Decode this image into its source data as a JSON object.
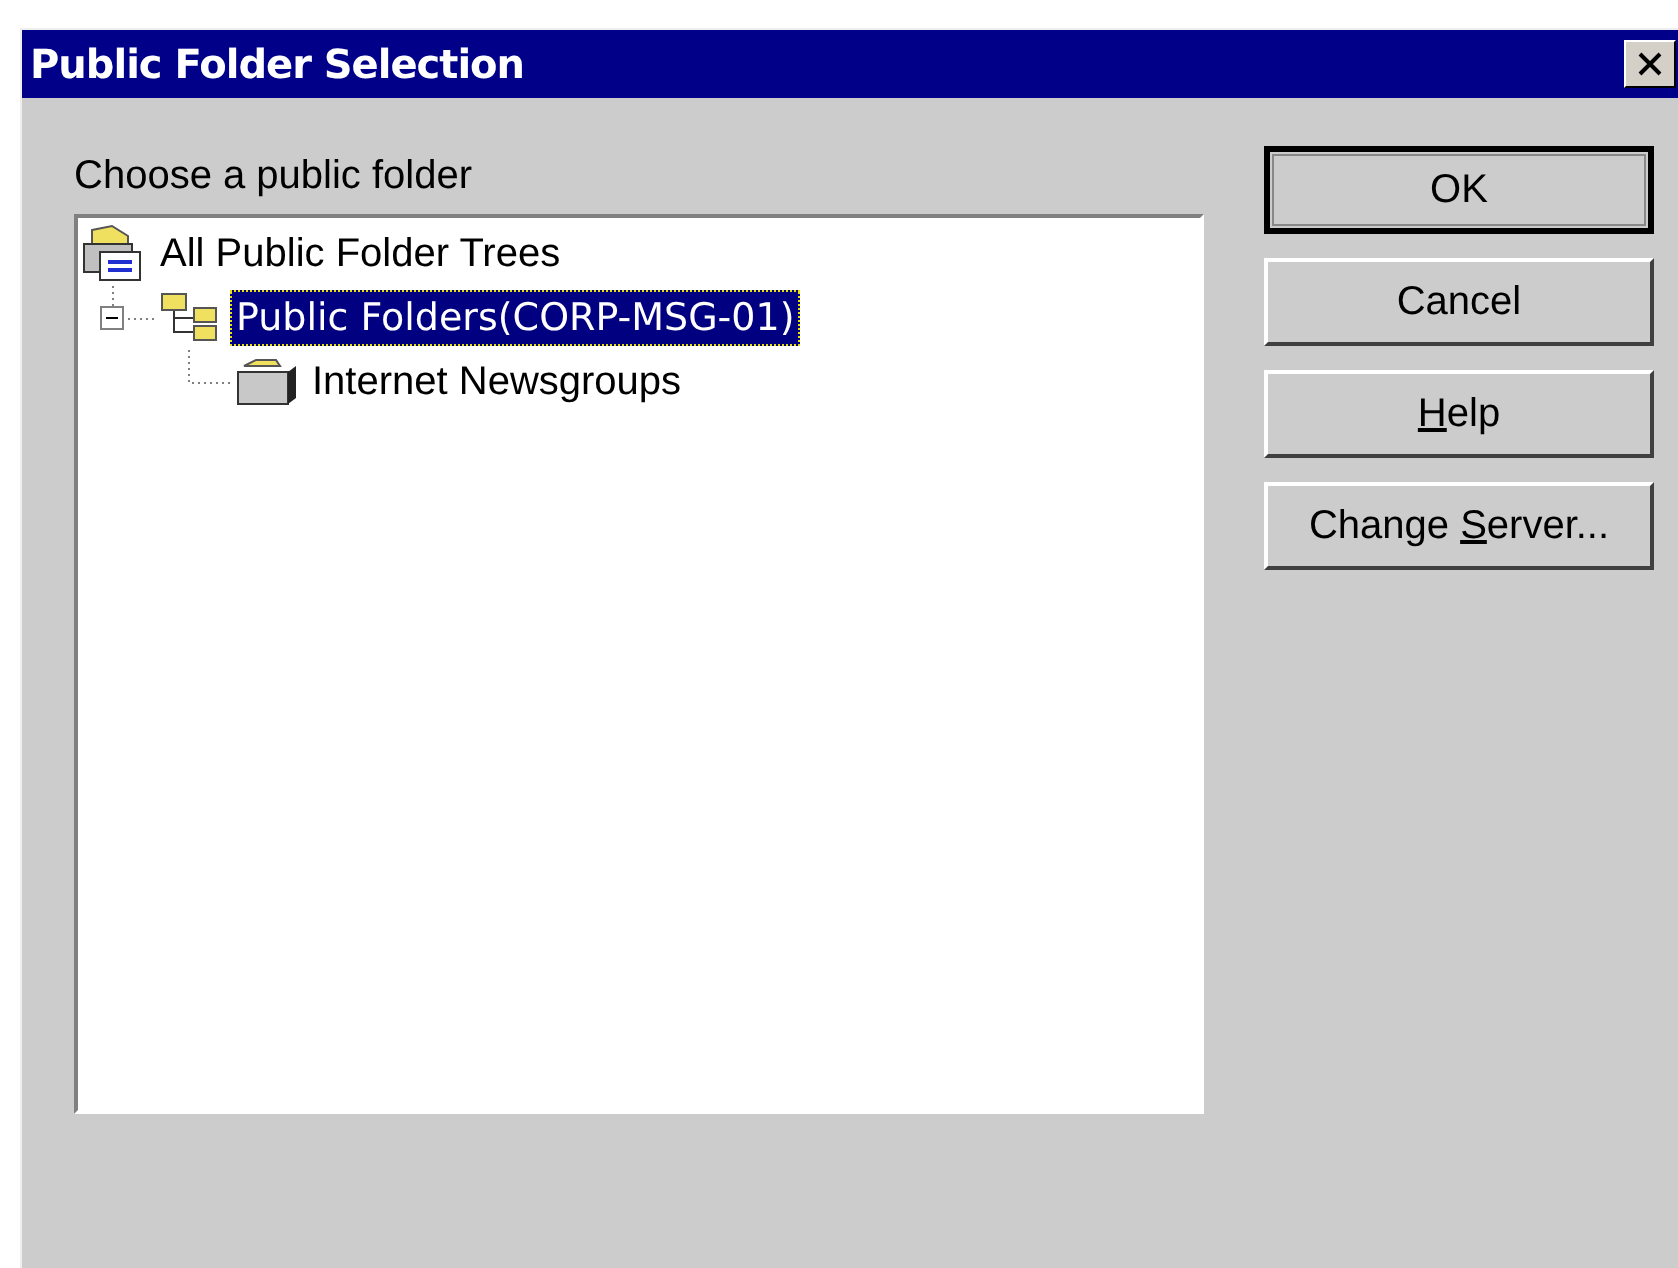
{
  "window": {
    "title": "Public Folder Selection"
  },
  "prompt": "Choose a public folder",
  "tree": [
    {
      "label": "All Public Folder Trees",
      "kind": "root",
      "selected": false,
      "children": [
        {
          "label": "Public Folders(CORP-MSG-01)",
          "kind": "store",
          "selected": true,
          "expanded": true,
          "children": [
            {
              "label": "Internet Newsgroups",
              "kind": "folder",
              "selected": false
            }
          ]
        }
      ]
    }
  ],
  "buttons": [
    {
      "text_before": "OK",
      "default": true
    },
    {
      "text_before": "Cancel",
      "default": false
    },
    {
      "access_key": "H",
      "text_after": "elp",
      "default": false
    },
    {
      "text_before": "Change ",
      "access_key": "S",
      "text_after": "erver...",
      "default": false
    }
  ]
}
